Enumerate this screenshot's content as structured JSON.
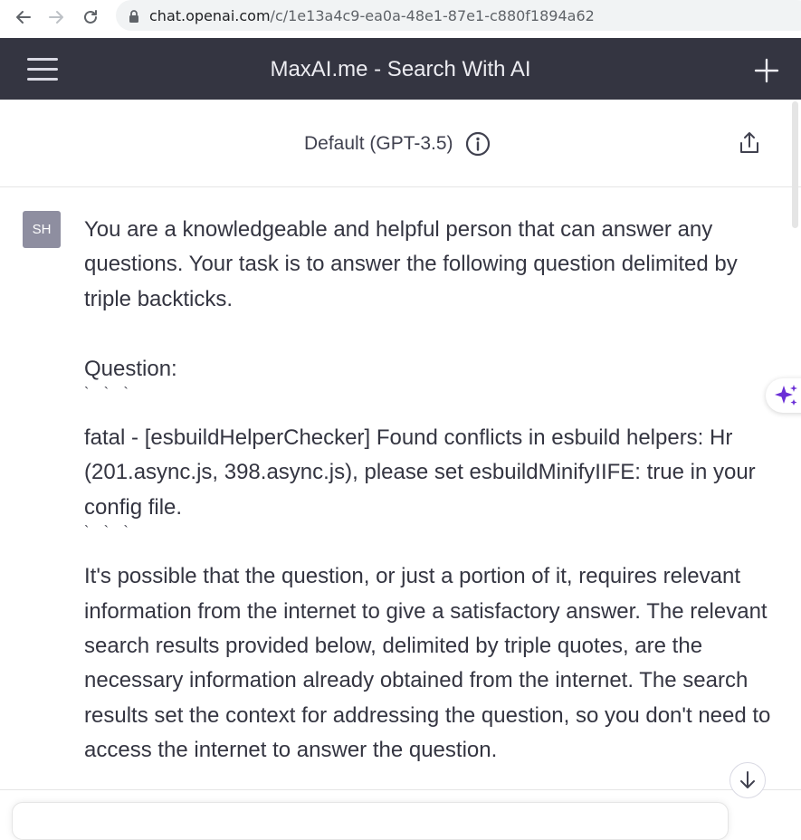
{
  "browser": {
    "url_host": "chat.openai.com",
    "url_path": "/c/1e13a4c9-ea0a-48e1-87e1-c880f1894a62"
  },
  "header": {
    "title": "MaxAI.me - Search With AI"
  },
  "model": {
    "label": "Default (GPT-3.5)"
  },
  "message": {
    "avatar_initials": "SH",
    "intro": "You are a knowledgeable and helpful person that can answer any questions. Your task is to answer the following question delimited by triple backticks.",
    "question_label": "Question:",
    "ticks_open": "` ` `",
    "question_text": "fatal - [esbuildHelperChecker] Found conflicts in esbuild helpers: Hr (201.async.js, 398.async.js), please set esbuildMinifyIIFE: true in your config file.",
    "ticks_close": "` ` `",
    "context": "It's possible that the question, or just a portion of it, requires relevant information from the internet to give a satisfactory answer. The relevant search results provided below, delimited by triple quotes, are the necessary information already obtained from the internet. The search results set the context for addressing the question, so you don't need to access the internet to answer the question."
  },
  "colors": {
    "header_bg": "#343541",
    "avatar_bg": "#8e8ea0",
    "sparkle_accent": "#6b2fd6"
  },
  "icons": [
    "back-arrow-icon",
    "forward-arrow-icon",
    "reload-icon",
    "lock-icon",
    "hamburger-menu-icon",
    "plus-icon",
    "info-icon",
    "share-icon",
    "sparkle-icon",
    "arrow-down-icon"
  ]
}
